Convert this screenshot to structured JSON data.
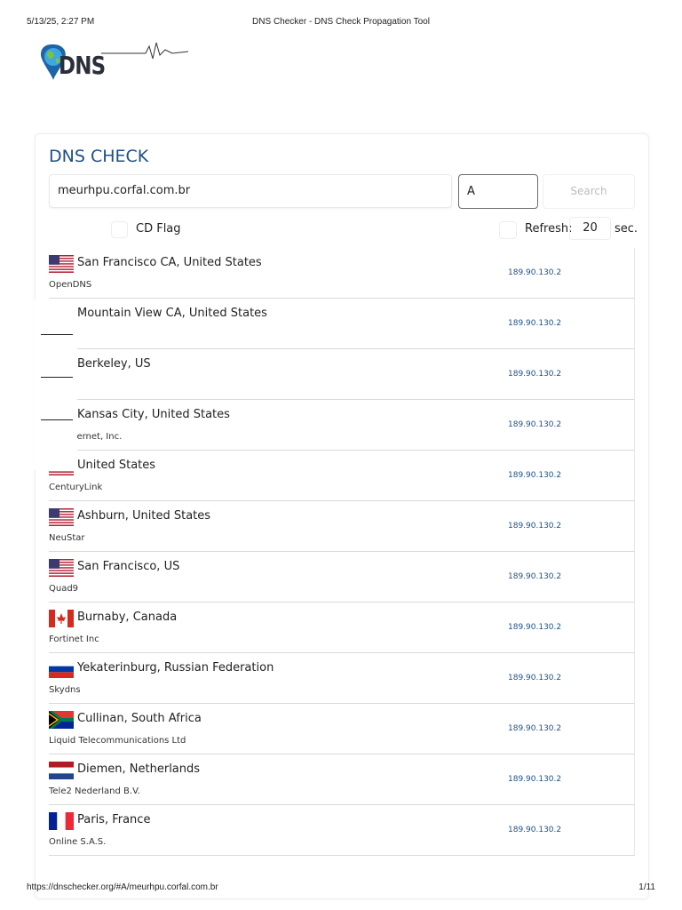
{
  "print_header": {
    "date": "5/13/25, 2:27 PM",
    "title": "DNS Checker - DNS Check Propagation Tool"
  },
  "print_footer": {
    "url": "https://dnschecker.org/#A/meurhpu.corfal.com.br",
    "page": "1/11"
  },
  "logo": {
    "text": "DNS"
  },
  "card": {
    "title": "DNS CHECK"
  },
  "search": {
    "domain": "meurhpu.corfal.com.br",
    "record_type": "A",
    "button": "Search"
  },
  "options": {
    "cd_flag_label": "CD Flag",
    "refresh_label": "Refresh:",
    "refresh_value": "20",
    "refresh_unit": "sec."
  },
  "colors": {
    "title": "#1f4f86",
    "ip": "#1f4f86"
  },
  "results": [
    {
      "flag": "us",
      "location": "San Francisco CA, United States",
      "provider": "OpenDNS",
      "ip": "189.90.130.2"
    },
    {
      "flag": "us",
      "location": "Mountain View CA, United States",
      "provider": "",
      "ip": "189.90.130.2"
    },
    {
      "flag": "us",
      "location": "Berkeley, US",
      "provider": "",
      "ip": "189.90.130.2"
    },
    {
      "flag": "us",
      "location": "Kansas City, United States",
      "provider": "ale Internet, Inc.",
      "ip": "189.90.130.2"
    },
    {
      "flag": "us",
      "location": "United States",
      "provider": "CenturyLink",
      "ip": "189.90.130.2"
    },
    {
      "flag": "us",
      "location": "Ashburn, United States",
      "provider": "NeuStar",
      "ip": "189.90.130.2"
    },
    {
      "flag": "us",
      "location": "San Francisco, US",
      "provider": "Quad9",
      "ip": "189.90.130.2"
    },
    {
      "flag": "ca",
      "location": "Burnaby, Canada",
      "provider": "Fortinet Inc",
      "ip": "189.90.130.2"
    },
    {
      "flag": "ru",
      "location": "Yekaterinburg, Russian Federation",
      "provider": "Skydns",
      "ip": "189.90.130.2"
    },
    {
      "flag": "za",
      "location": "Cullinan, South Africa",
      "provider": "Liquid Telecommunications Ltd",
      "ip": "189.90.130.2"
    },
    {
      "flag": "nl",
      "location": "Diemen, Netherlands",
      "provider": "Tele2 Nederland B.V.",
      "ip": "189.90.130.2"
    },
    {
      "flag": "fr",
      "location": "Paris, France",
      "provider": "Online S.A.S.",
      "ip": "189.90.130.2"
    }
  ]
}
